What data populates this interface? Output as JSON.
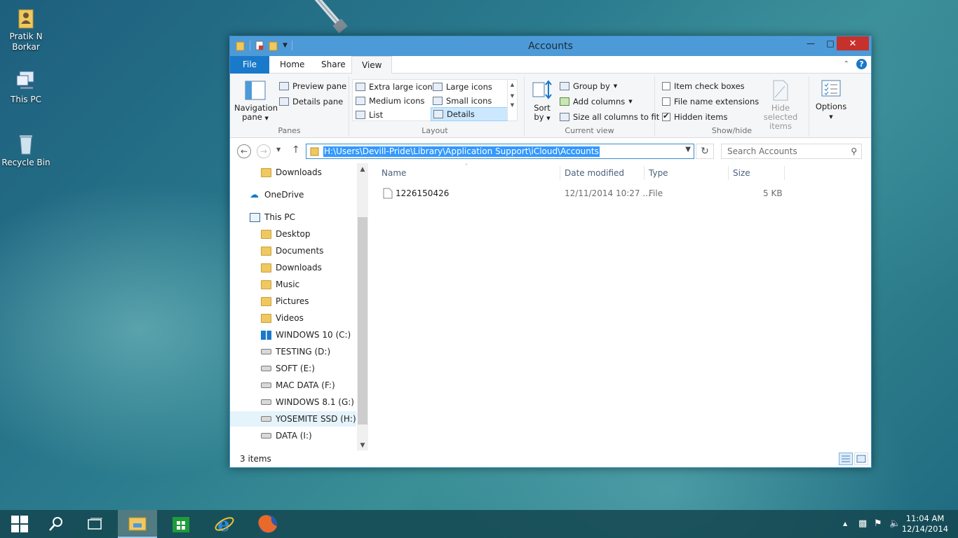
{
  "desktop": {
    "icons": [
      {
        "label": "Pratik N Borkar",
        "icon": "user-folder-icon"
      },
      {
        "label": "This PC",
        "icon": "this-pc-icon"
      },
      {
        "label": "Recycle Bin",
        "icon": "recycle-bin-icon"
      }
    ]
  },
  "window": {
    "title": "Accounts",
    "controls": {
      "minimize": "—",
      "maximize": "□",
      "close": "✕"
    },
    "tabs": {
      "file": "File",
      "home": "Home",
      "share": "Share",
      "view": "View"
    },
    "help": "?"
  },
  "ribbon": {
    "panes": {
      "navigation_pane": "Navigation pane",
      "preview_pane": "Preview pane",
      "details_pane": "Details pane",
      "label": "Panes"
    },
    "layout": {
      "extra_large_icons": "Extra large icons",
      "large_icons": "Large icons",
      "medium_icons": "Medium icons",
      "small_icons": "Small icons",
      "list": "List",
      "details": "Details",
      "selected": "Details",
      "label": "Layout"
    },
    "current_view": {
      "sort_by": "Sort by",
      "group_by": "Group by",
      "add_columns": "Add columns",
      "size_all_columns": "Size all columns to fit",
      "label": "Current view"
    },
    "show_hide": {
      "item_check_boxes": "Item check boxes",
      "item_check_boxes_checked": false,
      "file_name_extensions": "File name extensions",
      "file_name_extensions_checked": false,
      "hidden_items": "Hidden items",
      "hidden_items_checked": true,
      "hide_selected_items": "Hide selected items",
      "label": "Show/hide"
    },
    "options": "Options"
  },
  "address": {
    "path": "H:\\Users\\Devill-Pride\\Library\\Application Support\\iCloud\\Accounts",
    "search_placeholder": "Search Accounts"
  },
  "nav_pane": {
    "items": [
      {
        "label": "Downloads",
        "icon": "downloads-folder-icon",
        "level": 2
      },
      {
        "label": "OneDrive",
        "icon": "onedrive-icon",
        "level": 1
      },
      {
        "label": "This PC",
        "icon": "this-pc-icon",
        "level": 1
      },
      {
        "label": "Desktop",
        "icon": "desktop-folder-icon",
        "level": 2
      },
      {
        "label": "Documents",
        "icon": "documents-folder-icon",
        "level": 2
      },
      {
        "label": "Downloads",
        "icon": "downloads-folder-icon",
        "level": 2
      },
      {
        "label": "Music",
        "icon": "music-folder-icon",
        "level": 2
      },
      {
        "label": "Pictures",
        "icon": "pictures-folder-icon",
        "level": 2
      },
      {
        "label": "Videos",
        "icon": "videos-folder-icon",
        "level": 2
      },
      {
        "label": "WINDOWS 10 (C:)",
        "icon": "windows-drive-icon",
        "level": 2
      },
      {
        "label": "TESTING (D:)",
        "icon": "drive-icon",
        "level": 2
      },
      {
        "label": "SOFT (E:)",
        "icon": "drive-icon",
        "level": 2
      },
      {
        "label": "MAC DATA (F:)",
        "icon": "drive-icon",
        "level": 2
      },
      {
        "label": "WINDOWS 8.1 (G:)",
        "icon": "drive-icon",
        "level": 2
      },
      {
        "label": "YOSEMITE SSD (H:)",
        "icon": "drive-icon",
        "level": 2,
        "selected": true
      },
      {
        "label": "DATA (I:)",
        "icon": "drive-icon",
        "level": 2
      }
    ]
  },
  "file_list": {
    "columns": {
      "name": "Name",
      "date_modified": "Date modified",
      "type": "Type",
      "size": "Size"
    },
    "rows": [
      {
        "name": "1226150426",
        "date_modified": "12/11/2014 10:27 ...",
        "type": "File",
        "size": "5 KB"
      }
    ]
  },
  "status_bar": {
    "item_count": "3 items"
  },
  "taskbar": {
    "buttons": [
      "start-icon",
      "search-icon",
      "task-view-icon",
      "file-explorer-icon",
      "store-icon",
      "internet-explorer-icon",
      "firefox-icon"
    ],
    "clock_time": "11:04 AM",
    "clock_date": "12/14/2014"
  },
  "colors": {
    "title_bar": "#4d9ad8",
    "file_tab": "#1979ca",
    "close_button": "#c7312b",
    "selection": "#3399ff"
  }
}
